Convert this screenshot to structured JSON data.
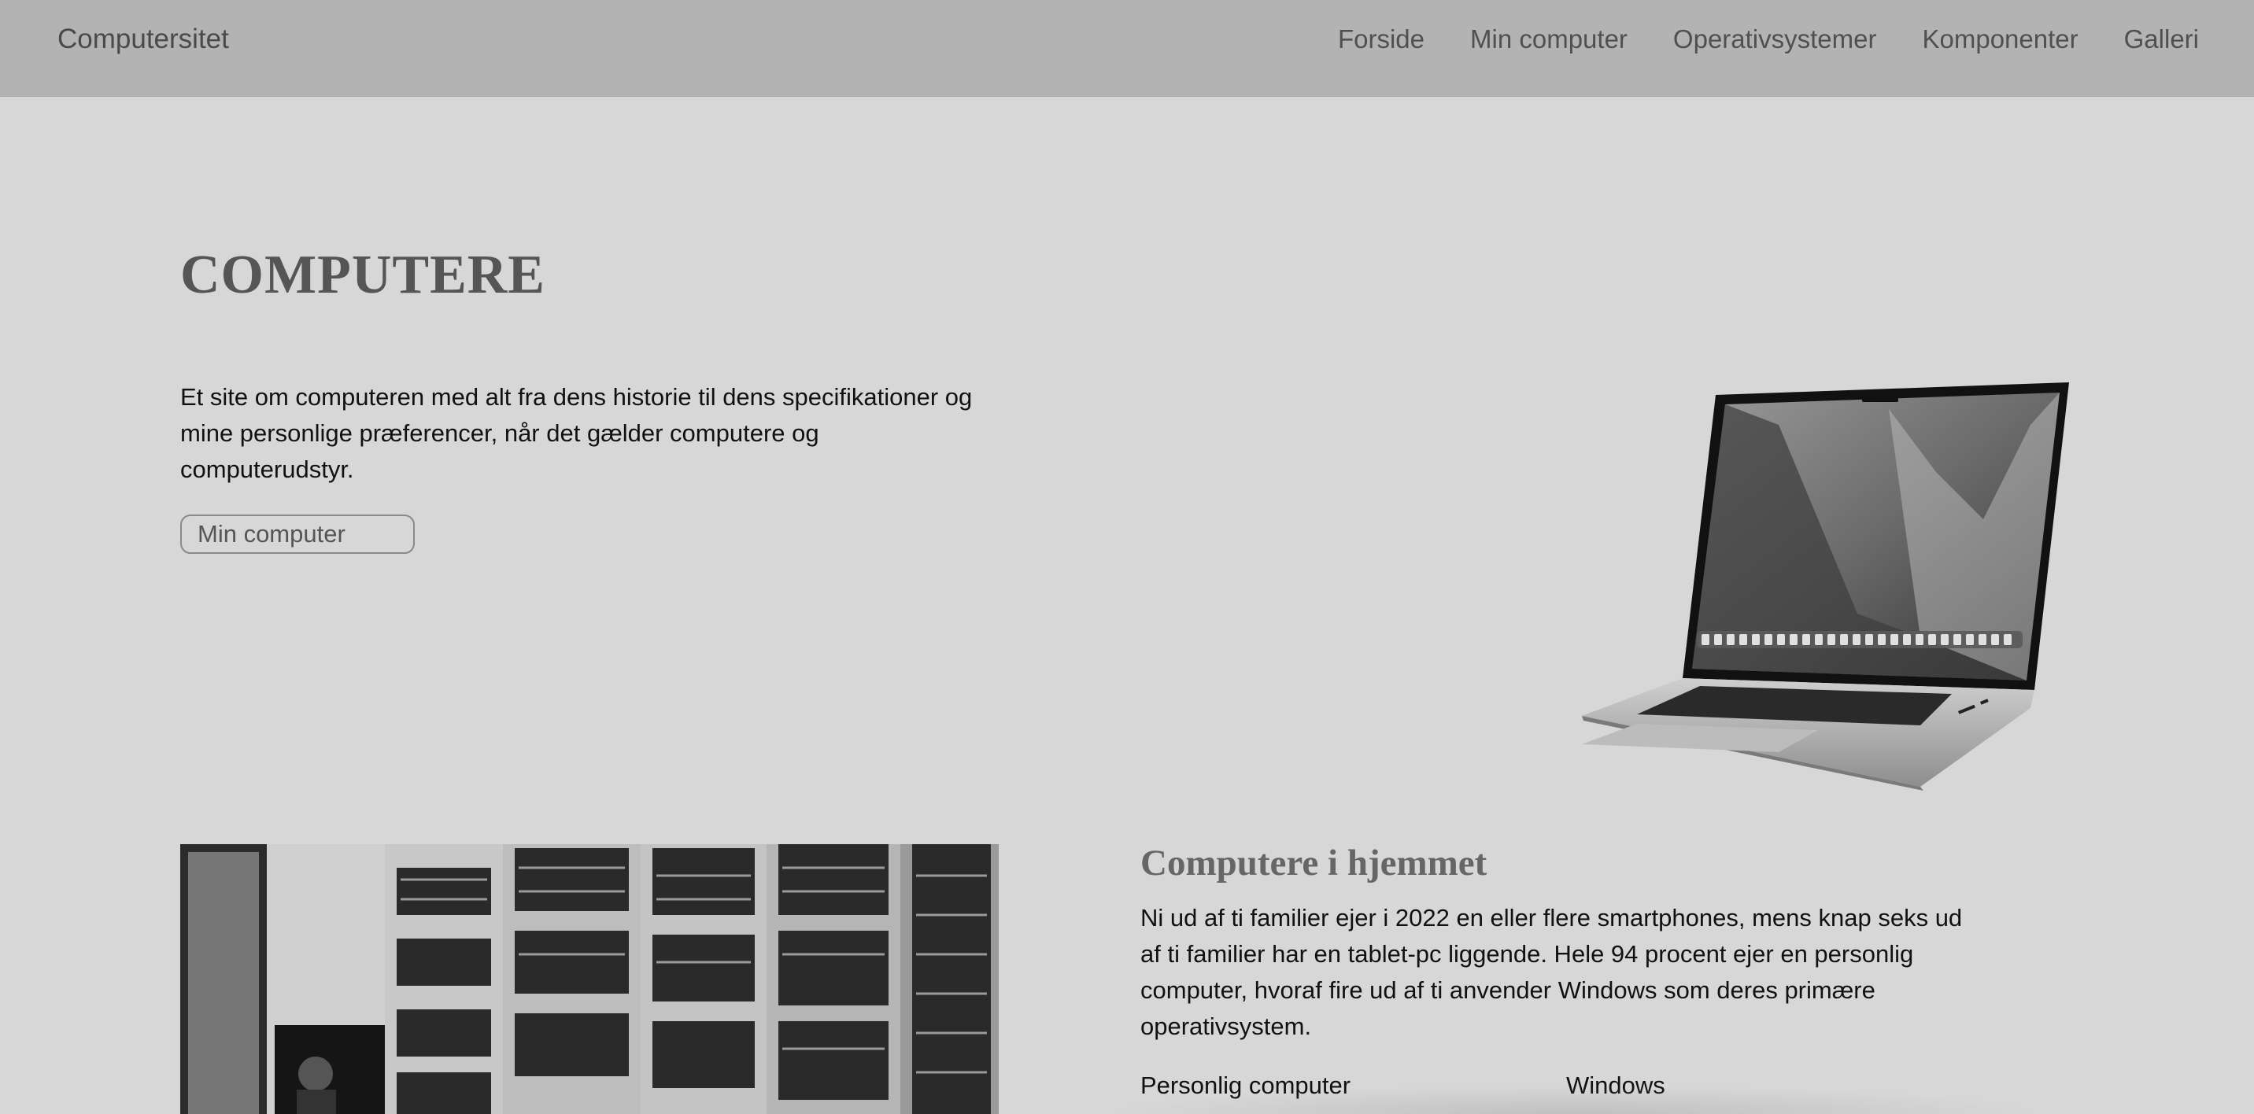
{
  "navbar": {
    "brand": "Computersitet",
    "links": [
      "Forside",
      "Min computer",
      "Operativsystemer",
      "Komponenter",
      "Galleri"
    ]
  },
  "hero": {
    "title": "COMPUTERE",
    "text": "Et site om computeren med alt fra dens historie til dens specifikationer og mine personlige præferencer, når det gælder computere og computerudstyr.",
    "button_label": "Min computer"
  },
  "home_section": {
    "title": "Computere i hjemmet",
    "text": "Ni ud af ti familier ejer i 2022 en eller flere smartphones, mens knap seks ud af ti familier har en tablet-pc liggende. Hele 94 procent ejer en personlig computer, hvoraf fire ud af ti anvender Windows som deres primære operativsystem.",
    "table_labels": [
      "Personlig computer",
      "Windows"
    ]
  },
  "colors": {
    "page_bg": "#d7d7d7",
    "navbar_bg": "#b3b3b3",
    "heading": "#555555"
  },
  "images": {
    "laptop": "laptop-image",
    "photo": "vintage-computer-room-photo"
  }
}
